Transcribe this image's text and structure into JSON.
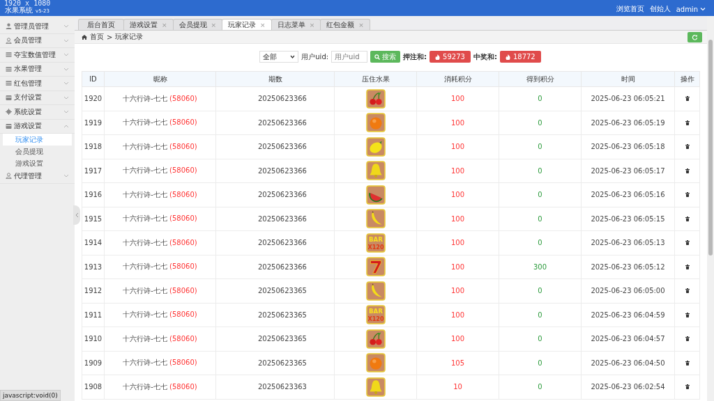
{
  "header": {
    "resolution": "1920 x 1080",
    "title": "水果系统",
    "version": "v5-23",
    "links": [
      "浏览首页",
      "创始人"
    ],
    "user": "admin"
  },
  "sidebar": {
    "items": [
      {
        "label": "管理员管理",
        "kind": "user",
        "expanded": false
      },
      {
        "label": "会员管理",
        "kind": "user-outline",
        "expanded": false
      },
      {
        "label": "夺宝数值管理",
        "kind": "table",
        "expanded": false
      },
      {
        "label": "水果管理",
        "kind": "table",
        "expanded": false
      },
      {
        "label": "红包管理",
        "kind": "table",
        "expanded": false
      },
      {
        "label": "支付设置",
        "kind": "card",
        "expanded": false
      },
      {
        "label": "系统设置",
        "kind": "gear",
        "expanded": false
      },
      {
        "label": "游戏设置",
        "kind": "card",
        "expanded": true,
        "children": [
          {
            "label": "玩家记录",
            "selected": true
          },
          {
            "label": "会员提现",
            "selected": false
          },
          {
            "label": "游戏设置",
            "selected": false
          }
        ]
      },
      {
        "label": "代理管理",
        "kind": "user-outline",
        "expanded": false
      }
    ]
  },
  "tabs": [
    {
      "label": "后台首页",
      "selected": false
    },
    {
      "label": "游戏设置",
      "close": "×",
      "selected": false
    },
    {
      "label": "会员提现",
      "close": "×",
      "selected": false
    },
    {
      "label": "玩家记录",
      "close": "×",
      "selected": true
    },
    {
      "label": "日志菜单",
      "close": "×",
      "selected": false
    },
    {
      "label": "红包金额",
      "close": "×",
      "selected": false
    }
  ],
  "breadcrumb": [
    "首页",
    "玩家记录"
  ],
  "breadcrumb_separator": ">",
  "filter": {
    "select": "全部",
    "uid_label": "用户uid:",
    "uid_placeholder": "用户uid",
    "search_button": "搜索",
    "bet_label": "押注和:",
    "bet_total": "59273",
    "win_label": "中奖和:",
    "win_total": "18772"
  },
  "table": {
    "columns": [
      "ID",
      "昵称",
      "期数",
      "压住水果",
      "消耗积分",
      "得到积分",
      "时间",
      "操作"
    ],
    "rows": [
      {
        "id": "1920",
        "nickname": "十六行诗-七七",
        "uid": "(58060)",
        "period": "20250623366",
        "fruit": {
          "kind": "cherry"
        },
        "spent": "100",
        "gained": "0",
        "time": "2025-06-23 06:05:21"
      },
      {
        "id": "1919",
        "nickname": "十六行诗-七七",
        "uid": "(58060)",
        "period": "20250623366",
        "fruit": {
          "kind": "orange"
        },
        "spent": "100",
        "gained": "0",
        "time": "2025-06-23 06:05:19"
      },
      {
        "id": "1918",
        "nickname": "十六行诗-七七",
        "uid": "(58060)",
        "period": "20250623366",
        "fruit": {
          "kind": "lemon"
        },
        "spent": "100",
        "gained": "0",
        "time": "2025-06-23 06:05:18"
      },
      {
        "id": "1917",
        "nickname": "十六行诗-七七",
        "uid": "(58060)",
        "period": "20250623366",
        "fruit": {
          "kind": "bell"
        },
        "spent": "100",
        "gained": "0",
        "time": "2025-06-23 06:05:17"
      },
      {
        "id": "1916",
        "nickname": "十六行诗-七七",
        "uid": "(58060)",
        "period": "20250623366",
        "fruit": {
          "kind": "watermelon"
        },
        "spent": "100",
        "gained": "0",
        "time": "2025-06-23 06:05:16"
      },
      {
        "id": "1915",
        "nickname": "十六行诗-七七",
        "uid": "(58060)",
        "period": "20250623366",
        "fruit": {
          "kind": "banana"
        },
        "spent": "100",
        "gained": "0",
        "time": "2025-06-23 06:05:15"
      },
      {
        "id": "1914",
        "nickname": "十六行诗-七七",
        "uid": "(58060)",
        "period": "20250623366",
        "fruit": {
          "kind": "bar",
          "label": "BAR",
          "multiplier": "X120"
        },
        "spent": "100",
        "gained": "0",
        "time": "2025-06-23 06:05:13"
      },
      {
        "id": "1913",
        "nickname": "十六行诗-七七",
        "uid": "(58060)",
        "period": "20250623366",
        "fruit": {
          "kind": "seven"
        },
        "spent": "100",
        "gained": "300",
        "time": "2025-06-23 06:05:12"
      },
      {
        "id": "1912",
        "nickname": "十六行诗-七七",
        "uid": "(58060)",
        "period": "20250623365",
        "fruit": {
          "kind": "banana"
        },
        "spent": "100",
        "gained": "0",
        "time": "2025-06-23 06:05:00"
      },
      {
        "id": "1911",
        "nickname": "十六行诗-七七",
        "uid": "(58060)",
        "period": "20250623365",
        "fruit": {
          "kind": "bar",
          "label": "BAR",
          "multiplier": "X120"
        },
        "spent": "100",
        "gained": "0",
        "time": "2025-06-23 06:04:59"
      },
      {
        "id": "1910",
        "nickname": "十六行诗-七七",
        "uid": "(58060)",
        "period": "20250623365",
        "fruit": {
          "kind": "cherry"
        },
        "spent": "100",
        "gained": "0",
        "time": "2025-06-23 06:04:57"
      },
      {
        "id": "1909",
        "nickname": "十六行诗-七七",
        "uid": "(58060)",
        "period": "20250623365",
        "fruit": {
          "kind": "orange"
        },
        "spent": "105",
        "gained": "0",
        "time": "2025-06-23 06:04:50"
      },
      {
        "id": "1908",
        "nickname": "十六行诗-七七",
        "uid": "(58060)",
        "period": "20250623363",
        "fruit": {
          "kind": "bell"
        },
        "spent": "10",
        "gained": "0",
        "time": "2025-06-23 06:02:54"
      }
    ]
  },
  "status_tooltip": "javascript:void(0)"
}
